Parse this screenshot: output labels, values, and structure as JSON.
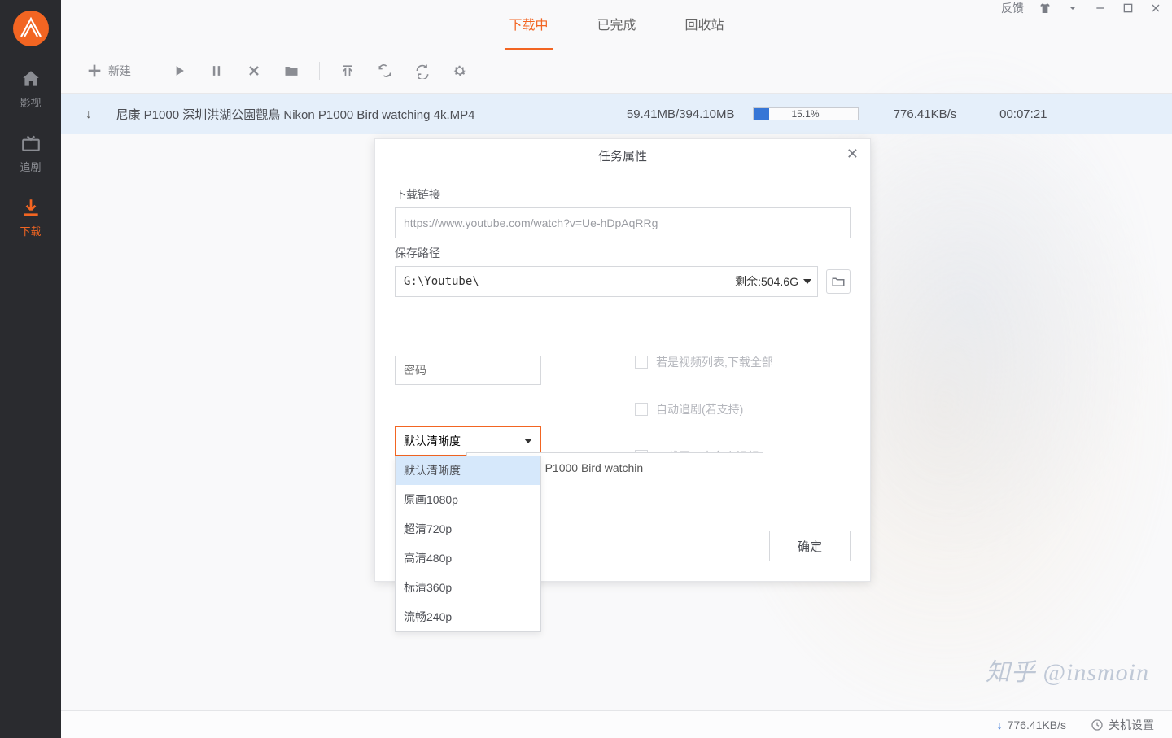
{
  "titlebar": {
    "feedback": "反馈"
  },
  "sidebar": {
    "items": [
      {
        "label": "影视"
      },
      {
        "label": "追剧"
      },
      {
        "label": "下载"
      }
    ]
  },
  "tabs": {
    "downloading": "下载中",
    "done": "已完成",
    "trash": "回收站"
  },
  "toolbar": {
    "new_label": "新建"
  },
  "row": {
    "name": "尼康 P1000 深圳洪湖公園觀鳥 Nikon P1000 Bird watching 4k.MP4",
    "size": "59.41MB/394.10MB",
    "pct_text": "15.1%",
    "pct_width": "15.1%",
    "speed": "776.41KB/s",
    "eta": "00:07:21"
  },
  "dialog": {
    "title": "任务属性",
    "url_label": "下载链接",
    "url_value": "https://www.youtube.com/watch?v=Ue-hDpAqRRg",
    "path_label": "保存路径",
    "path_value": "G:\\Youtube\\",
    "remain": "剩余:504.6G",
    "pwd_placeholder": "密码",
    "chk_playlist": "若是视频列表,下载全部",
    "chk_auto": "自动追剧(若支持)",
    "chk_multi": "下载页面内多个视频",
    "quality_selected": "默认清晰度",
    "quality_options": [
      "默认清晰度",
      "原画1080p",
      "超清720p",
      "高清480p",
      "标清360p",
      "流畅240p"
    ],
    "filename": "園觀鳥 Nikon P1000 Bird watchin",
    "ok": "确定"
  },
  "statusbar": {
    "speed": "776.41KB/s",
    "shutdown": "关机设置"
  },
  "watermark": "知乎 @insmoin"
}
